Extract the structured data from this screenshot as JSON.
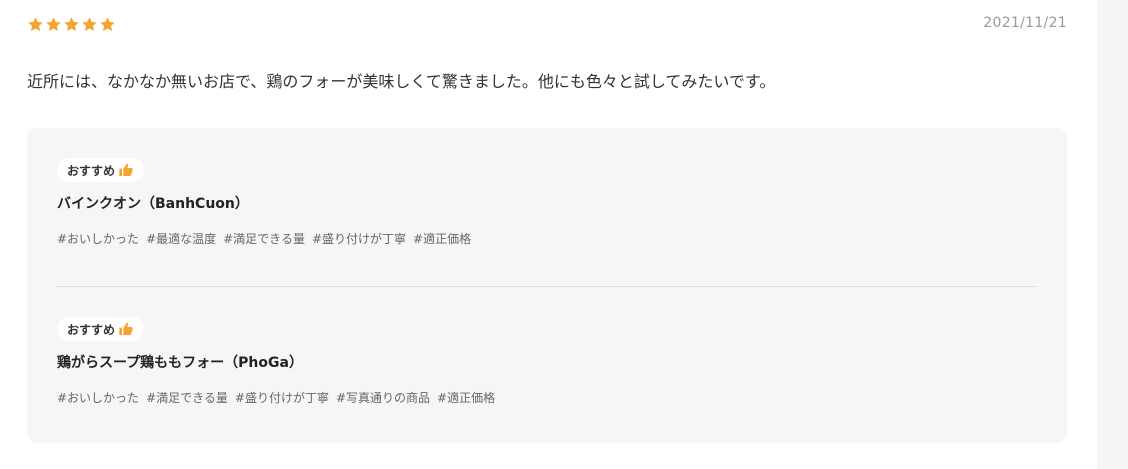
{
  "review": {
    "rating": 5,
    "date": "2021/11/21",
    "body": "近所には、なかなか無いお店で、鶏のフォーが美味しくて驚きました。他にも色々と試してみたいです。"
  },
  "colors": {
    "star": "#f3a52f",
    "thumb": "#f3a52f"
  },
  "recommendations": [
    {
      "badge": "おすすめ",
      "badge_icon": "thumbs-up-icon",
      "title": "バインクオン（BanhCuon）",
      "tags": [
        "#おいしかった",
        "#最適な温度",
        "#満足できる量",
        "#盛り付けが丁寧",
        "#適正価格"
      ]
    },
    {
      "badge": "おすすめ",
      "badge_icon": "thumbs-up-icon",
      "title": "鶏がらスープ鶏ももフォー（PhoGa）",
      "tags": [
        "#おいしかった",
        "#満足できる量",
        "#盛り付けが丁寧",
        "#写真通りの商品",
        "#適正価格"
      ]
    }
  ]
}
